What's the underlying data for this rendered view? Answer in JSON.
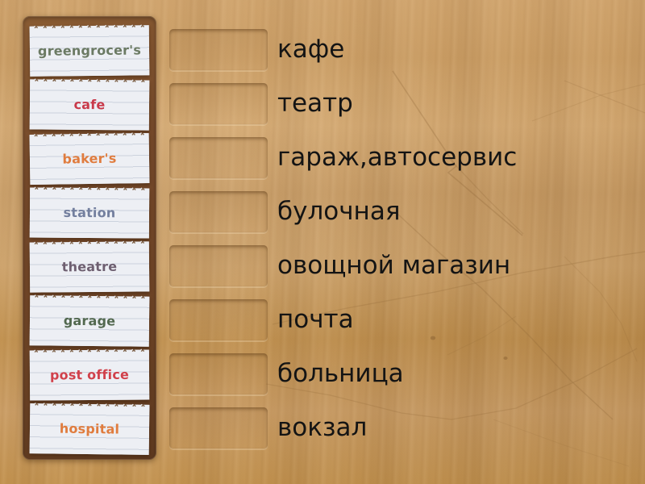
{
  "activity": {
    "type": "match-up-drag-and-drop",
    "background": "wood-board",
    "wood_color": "#c99c63",
    "panel_color": "#6d4426"
  },
  "word_panel": {
    "cards": [
      {
        "label": "greengrocer's",
        "color": "#6b7a63",
        "rotate": "-0.6deg"
      },
      {
        "label": "cafe",
        "color": "#c9394a",
        "rotate": "0.5deg"
      },
      {
        "label": "baker's",
        "color": "#e07c3e",
        "rotate": "-0.8deg"
      },
      {
        "label": "station",
        "color": "#737f9e",
        "rotate": "0.4deg"
      },
      {
        "label": "theatre",
        "color": "#6e5f70",
        "rotate": "-0.5deg"
      },
      {
        "label": "garage",
        "color": "#52684f",
        "rotate": "0.6deg"
      },
      {
        "label": "post office",
        "color": "#d1414b",
        "rotate": "-0.4deg"
      },
      {
        "label": "hospital",
        "color": "#e07c3e",
        "rotate": "0.7deg"
      }
    ]
  },
  "answer_rows": [
    {
      "drop_zone_label": "",
      "translation": "кафе"
    },
    {
      "drop_zone_label": "",
      "translation": "театр"
    },
    {
      "drop_zone_label": "",
      "translation": "гараж,автосервис"
    },
    {
      "drop_zone_label": "",
      "translation": "булочная"
    },
    {
      "drop_zone_label": "",
      "translation": "овощной магазин"
    },
    {
      "drop_zone_label": "",
      "translation": "почта"
    },
    {
      "drop_zone_label": "",
      "translation": "больница"
    },
    {
      "drop_zone_label": "",
      "translation": "вокзал"
    }
  ]
}
